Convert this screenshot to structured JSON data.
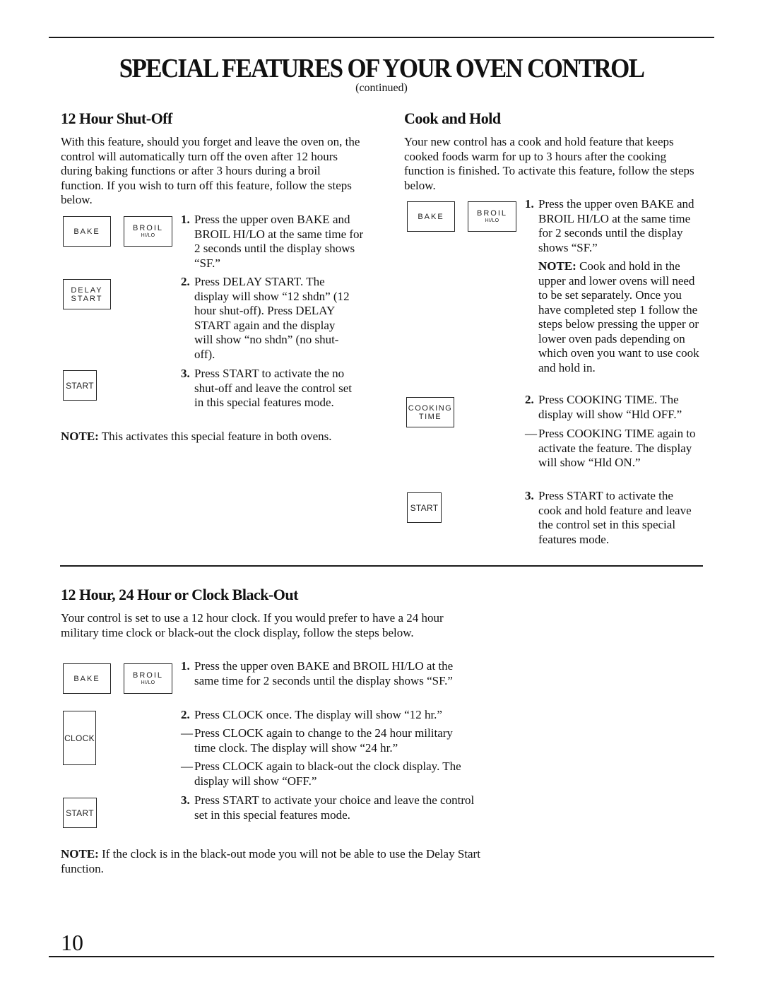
{
  "page": {
    "title": "SPECIAL FEATURES OF YOUR OVEN CONTROL",
    "subtitle": "(continued)",
    "page_number": "10"
  },
  "shutoff": {
    "heading": "12 Hour Shut-Off",
    "intro": "With this feature, should you forget and leave the oven on, the control will automatically turn off the oven after 12 hours during baking functions or after 3 hours during a broil function. If you wish to turn off this feature, follow the steps below.",
    "keys": {
      "bake": "BAKE",
      "broil": "BROIL",
      "broil_sub": "HI/LO",
      "delay_start": "DELAY START",
      "start": "START"
    },
    "steps": [
      {
        "num": "1.",
        "text": "Press the upper oven BAKE and BROIL HI/LO at the same time for 2 seconds until the display shows “SF.”"
      },
      {
        "num": "2.",
        "text": "Press DELAY START. The display will show “12 shdn” (12 hour shut-off). Press DELAY START again and the display will show “no shdn” (no shut-off)."
      },
      {
        "num": "3.",
        "text": "Press START to activate the no shut-off and leave the control set in this special features mode."
      }
    ],
    "note_label": "NOTE:",
    "note_text": " This activates this special feature in both ovens."
  },
  "cookhold": {
    "heading": "Cook and Hold",
    "intro": "Your new control has a cook and hold feature that keeps cooked foods warm for up to 3 hours after the cooking function is finished. To activate this feature, follow the steps below.",
    "keys": {
      "bake": "BAKE",
      "broil": "BROIL",
      "broil_sub": "HI/LO",
      "cooking_time_1": "COOKING",
      "cooking_time_2": "TIME",
      "start": "START"
    },
    "step1": {
      "num": "1.",
      "text": "Press the upper oven BAKE and BROIL HI/LO at the same time for 2 seconds until the display shows “SF.”"
    },
    "note_label": "NOTE:",
    "note_text": " Cook and hold in the upper and lower ovens will need to be set separately. Once you have completed step 1 follow the steps below pressing the upper or lower oven pads depending on which oven you want to use cook and hold in.",
    "step2": {
      "num": "2.",
      "text": "Press COOKING TIME. The display will show “Hld OFF.”"
    },
    "step2b": {
      "dash": "—",
      "text": "Press COOKING TIME again to activate the feature. The display will show “Hld ON.”"
    },
    "step3": {
      "num": "3.",
      "text": "Press START to activate the cook and hold feature and leave the control set in this special features mode."
    }
  },
  "clock": {
    "heading": "12 Hour, 24 Hour or Clock Black-Out",
    "intro": "Your control is set to use a 12 hour clock. If you would prefer to have a 24 hour military time clock or black-out the clock display, follow the steps below.",
    "keys": {
      "bake": "BAKE",
      "broil": "BROIL",
      "broil_sub": "HI/LO",
      "clock": "CLOCK",
      "start": "START"
    },
    "step1": {
      "num": "1.",
      "text": "Press the upper oven BAKE and BROIL HI/LO at the same time for 2 seconds until the display shows “SF.”"
    },
    "step2": {
      "num": "2.",
      "text": "Press CLOCK once. The display will show “12 hr.”"
    },
    "step2b": {
      "dash": "—",
      "text": "Press CLOCK again to change to the 24 hour military time clock. The display will show “24 hr.”"
    },
    "step2c": {
      "dash": "—",
      "text": "Press CLOCK again to black-out the clock display. The display will show “OFF.”"
    },
    "step3": {
      "num": "3.",
      "text": "Press START to activate your choice and leave the control set in this special features mode."
    },
    "note_label": "NOTE:",
    "note_text": " If the clock is in the black-out mode you will not be able to use the Delay Start function."
  }
}
